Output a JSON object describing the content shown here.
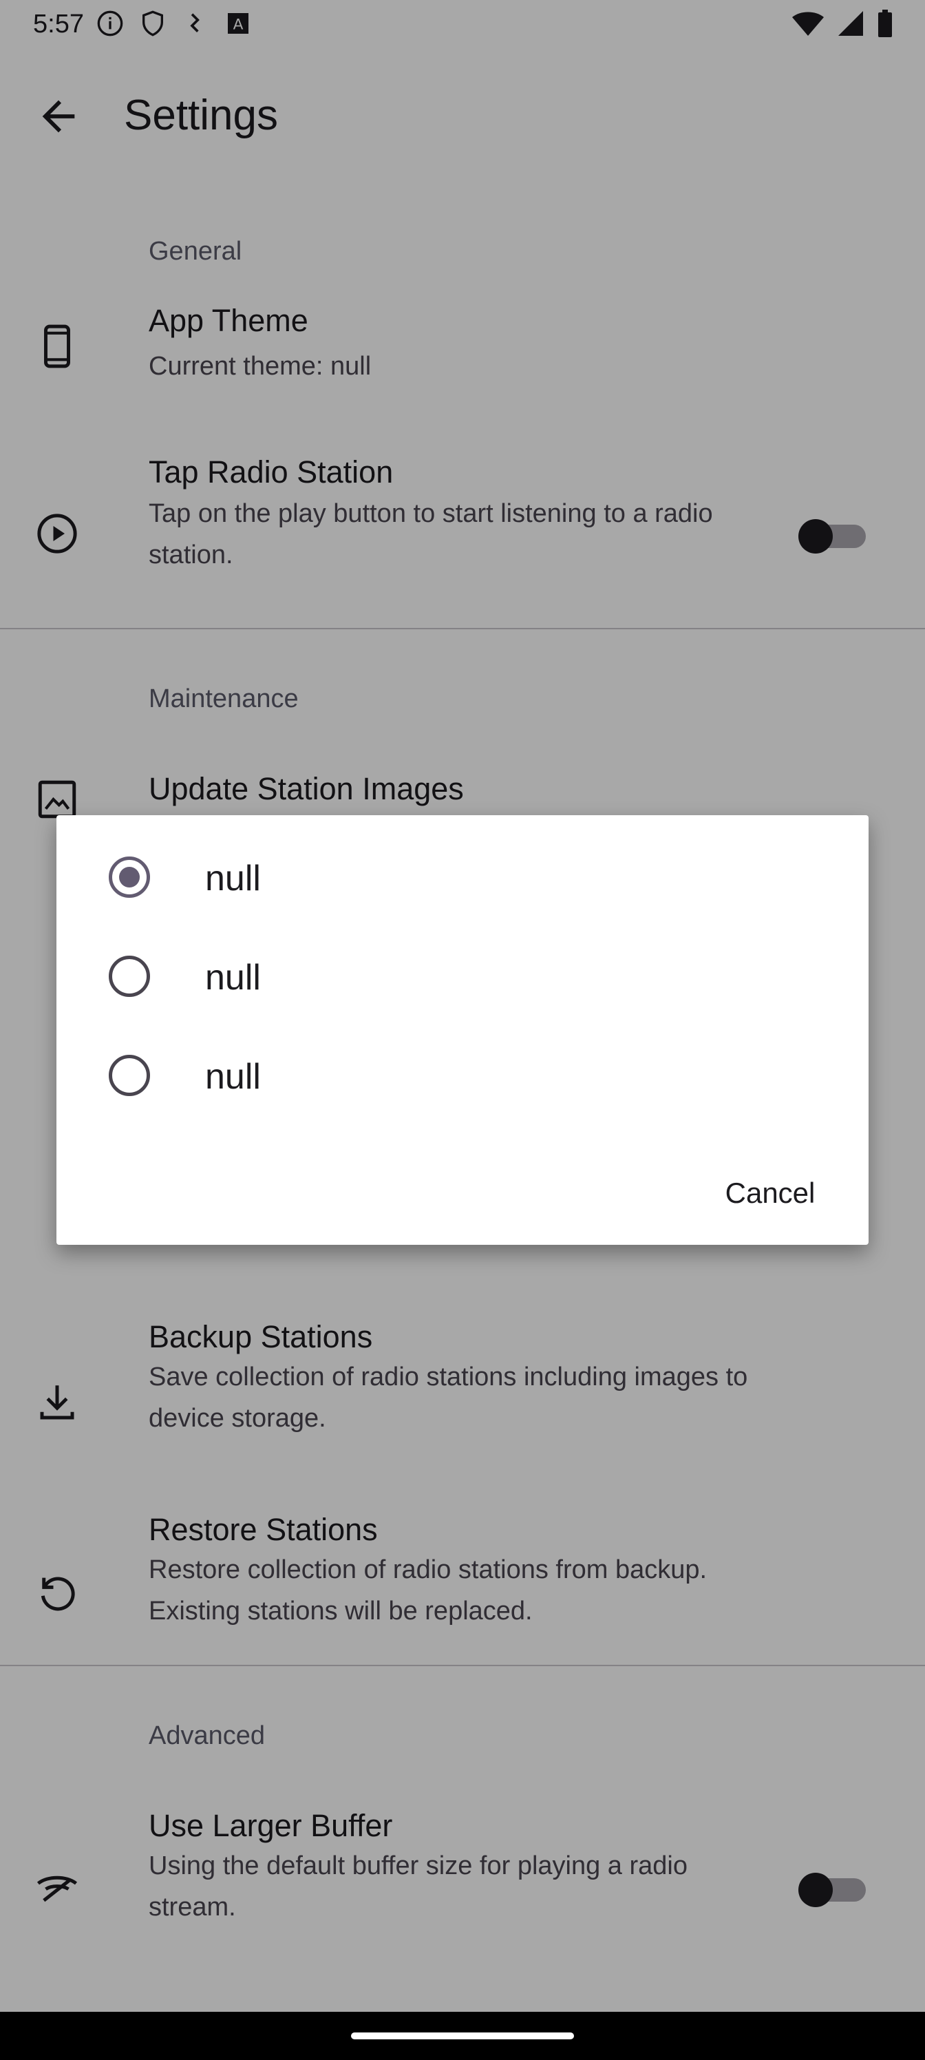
{
  "status_bar": {
    "time": "5:57",
    "left_icons": [
      "info-icon",
      "shield-icon",
      "usb-debug-icon",
      "font-a-icon"
    ],
    "right_icons": [
      "wifi-icon",
      "signal-icon",
      "battery-icon"
    ]
  },
  "app_bar": {
    "title": "Settings",
    "back_icon": "arrow-back-icon"
  },
  "sections": {
    "general": {
      "header": "General",
      "app_theme": {
        "title": "App Theme",
        "summary": "Current theme: null",
        "icon": "phone-icon"
      },
      "tap_radio": {
        "title": "Tap Radio Station",
        "summary": "Tap on the play button to start listening to a radio station.",
        "icon": "play-circle-icon",
        "toggle_on": false
      }
    },
    "maintenance": {
      "header": "Maintenance",
      "update_images": {
        "title": "Update Station Images",
        "icon": "image-icon"
      },
      "backup": {
        "title": "Backup Stations",
        "summary": "Save collection of radio stations including images to device storage.",
        "icon": "download-icon"
      },
      "restore": {
        "title": "Restore Stations",
        "summary": "Restore collection of radio stations from backup. Existing stations will be replaced.",
        "icon": "restore-icon"
      }
    },
    "advanced": {
      "header": "Advanced",
      "larger_buffer": {
        "title": "Use Larger Buffer",
        "summary": "Using the default buffer size for playing a radio stream.",
        "icon": "buffer-icon",
        "toggle_on": false
      }
    }
  },
  "dialog": {
    "options": [
      {
        "label": "null",
        "selected": true
      },
      {
        "label": "null",
        "selected": false
      },
      {
        "label": "null",
        "selected": false
      }
    ],
    "cancel_label": "Cancel"
  },
  "colors": {
    "accent": "#625b71",
    "scrim": "#000000",
    "dialog_bg": "#ffffff"
  }
}
